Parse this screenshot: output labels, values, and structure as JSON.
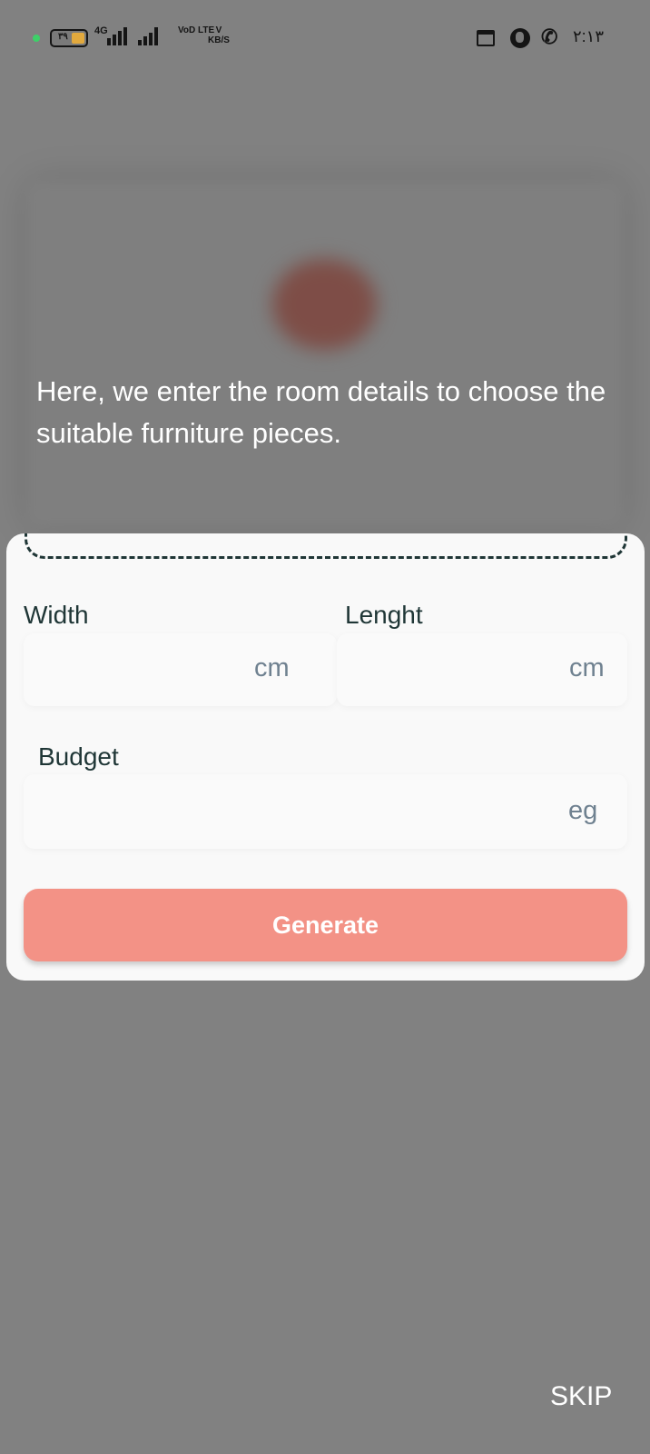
{
  "status_bar": {
    "battery": "٣٩",
    "network": "4G",
    "volte": "VoD LTE",
    "speed_value": "V",
    "speed_unit": "KB/S",
    "time": "٢:١٣"
  },
  "tutorial": {
    "text": "Here, we enter the room details to choose the suitable furniture pieces.",
    "skip_label": "SKIP"
  },
  "form": {
    "width_label": "Width",
    "width_unit": "cm",
    "length_label": "Lenght",
    "length_unit": "cm",
    "budget_label": "Budget",
    "budget_unit": "eg",
    "generate_label": "Generate"
  },
  "colors": {
    "accent": "#f39286",
    "label_text": "#1f3636",
    "unit_text": "#6f8190"
  }
}
